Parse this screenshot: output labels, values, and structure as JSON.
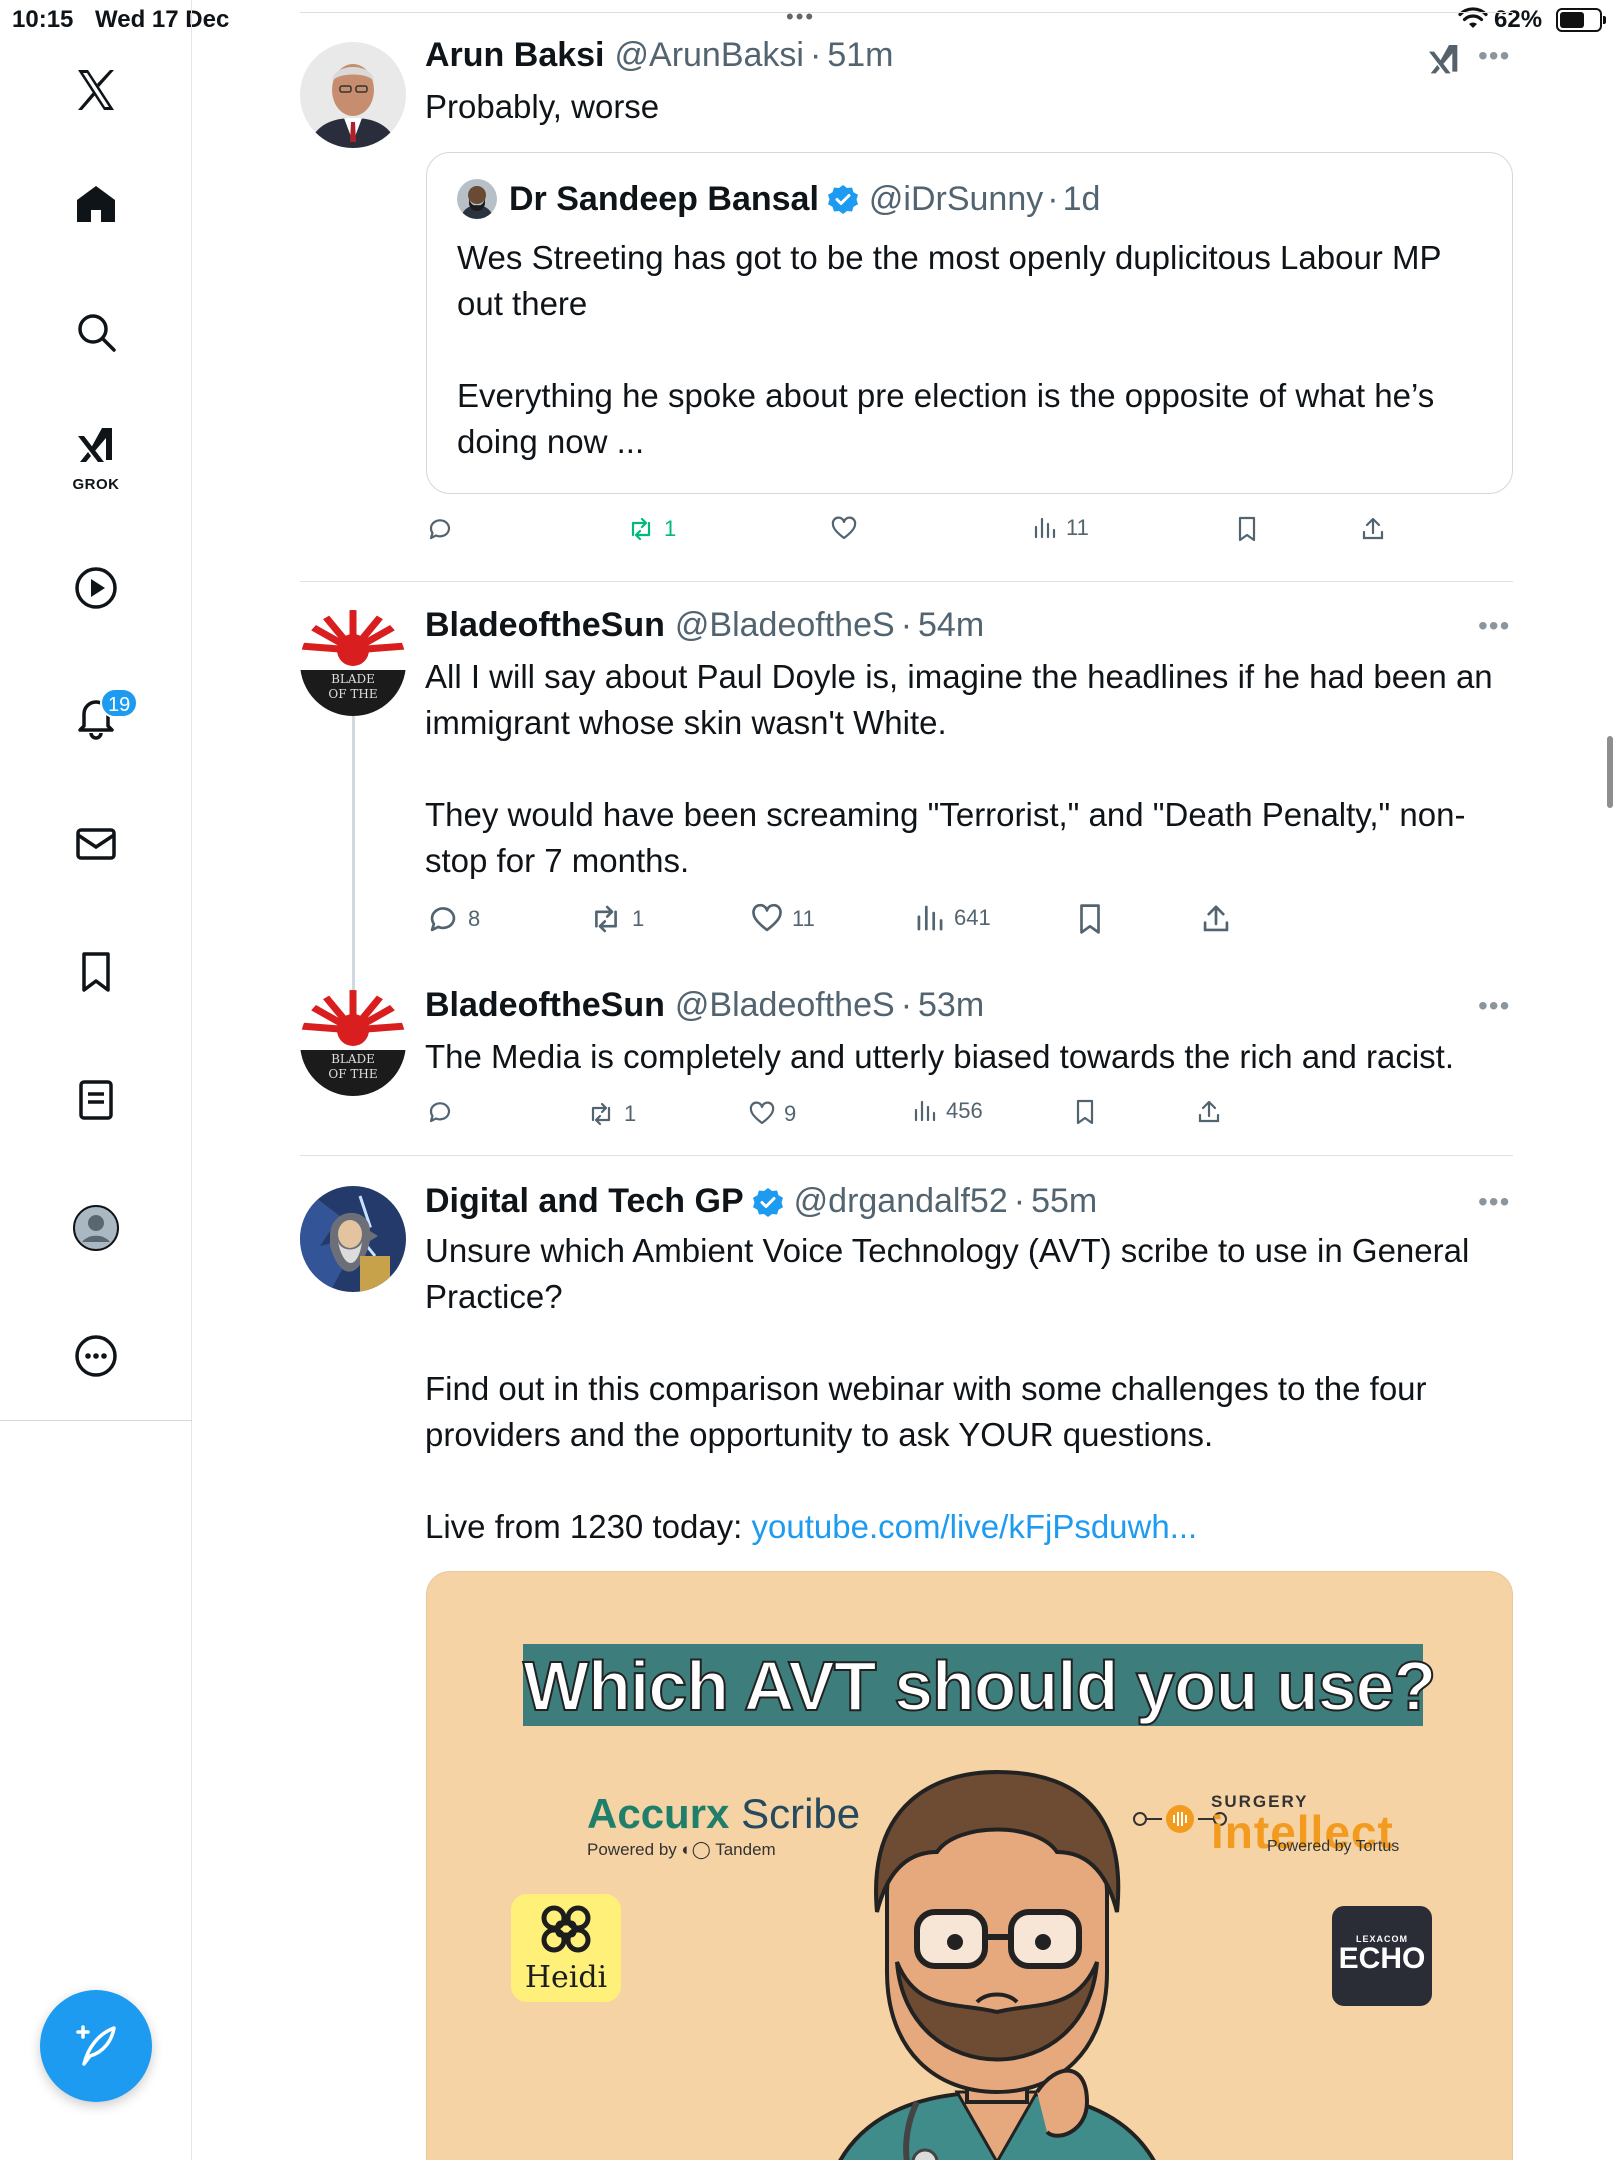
{
  "status_bar": {
    "time": "10:15",
    "date": "Wed 17 Dec",
    "battery": "62%",
    "battery_level": 0.62
  },
  "sidebar": {
    "items": [
      {
        "name": "x-logo",
        "icon": "x-logo-icon"
      },
      {
        "name": "home",
        "icon": "home-icon"
      },
      {
        "name": "explore",
        "icon": "search-icon"
      },
      {
        "name": "grok",
        "icon": "grok-icon",
        "label": "GROK"
      },
      {
        "name": "videos",
        "icon": "play-icon"
      },
      {
        "name": "notifications",
        "icon": "bell-icon",
        "badge": "19"
      },
      {
        "name": "messages",
        "icon": "mail-icon"
      },
      {
        "name": "bookmarks",
        "icon": "bookmark-icon"
      },
      {
        "name": "lists",
        "icon": "list-icon"
      },
      {
        "name": "profile",
        "icon": "profile-icon"
      },
      {
        "name": "more",
        "icon": "more-circle-icon"
      }
    ],
    "compose_icon": "compose-icon"
  },
  "colors": {
    "accent": "#1d9bf0",
    "text": "#0f1419",
    "secondary_text": "#536471",
    "retweet_green": "#00ba7c"
  },
  "tweets": [
    {
      "name": "Arun Baksi",
      "handle": "@ArunBaksi",
      "sep": "·",
      "time": "51m",
      "text": [
        "Probably, worse"
      ],
      "quote": {
        "name": "Dr Sandeep Bansal",
        "verified": true,
        "handle": "@iDrSunny",
        "sep": "·",
        "time": "1d",
        "text": [
          "Wes Streeting has got to be the most openly duplicitous Labour MP out there",
          "Everything he spoke about pre election is the opposite of what he’s doing now ..."
        ]
      },
      "actions": {
        "replies": "",
        "reposts": "1",
        "likes": "",
        "views": "11"
      }
    },
    {
      "name": "BladeoftheSun",
      "handle": "@BladeoftheS",
      "sep": "·",
      "time": "54m",
      "text": [
        "All I will say about Paul Doyle is, imagine the headlines if he had been an immigrant whose skin wasn't White.",
        "They would have been screaming \"Terrorist,\" and \"Death Penalty,\" non-stop for 7 months."
      ],
      "actions": {
        "replies": "8",
        "reposts": "1",
        "likes": "11",
        "views": "641"
      }
    },
    {
      "name": "BladeoftheSun",
      "handle": "@BladeoftheS",
      "sep": "·",
      "time": "53m",
      "text": [
        "The Media is completely and utterly biased towards the rich and racist."
      ],
      "actions": {
        "replies": "",
        "reposts": "1",
        "likes": "9",
        "views": "456"
      }
    },
    {
      "name": "Digital and Tech GP",
      "verified": true,
      "handle": "@drgandalf52",
      "sep": "·",
      "time": "55m",
      "text": [
        "Unsure which Ambient Voice Technology (AVT) scribe to use in General Practice?",
        "Find out in this comparison webinar with some challenges to the four providers and the opportunity to ask YOUR questions."
      ],
      "live_prefix": "Live from 1230 today: ",
      "link": "youtube.com/live/kFjPsduwh...",
      "media": {
        "title": "Which AVT should you use?",
        "accurx_a": "Accurx ",
        "accurx_b": "Scribe",
        "accurx_sub": "Powered by ◐◯ Tandem",
        "surgery_top": "SURGERY",
        "surgery_main": "intellect",
        "surgery_sub": "Powered by Tortus",
        "heidi": "Heidi",
        "echo_top": "LEXACOM",
        "echo_main": "ECHO"
      }
    }
  ]
}
